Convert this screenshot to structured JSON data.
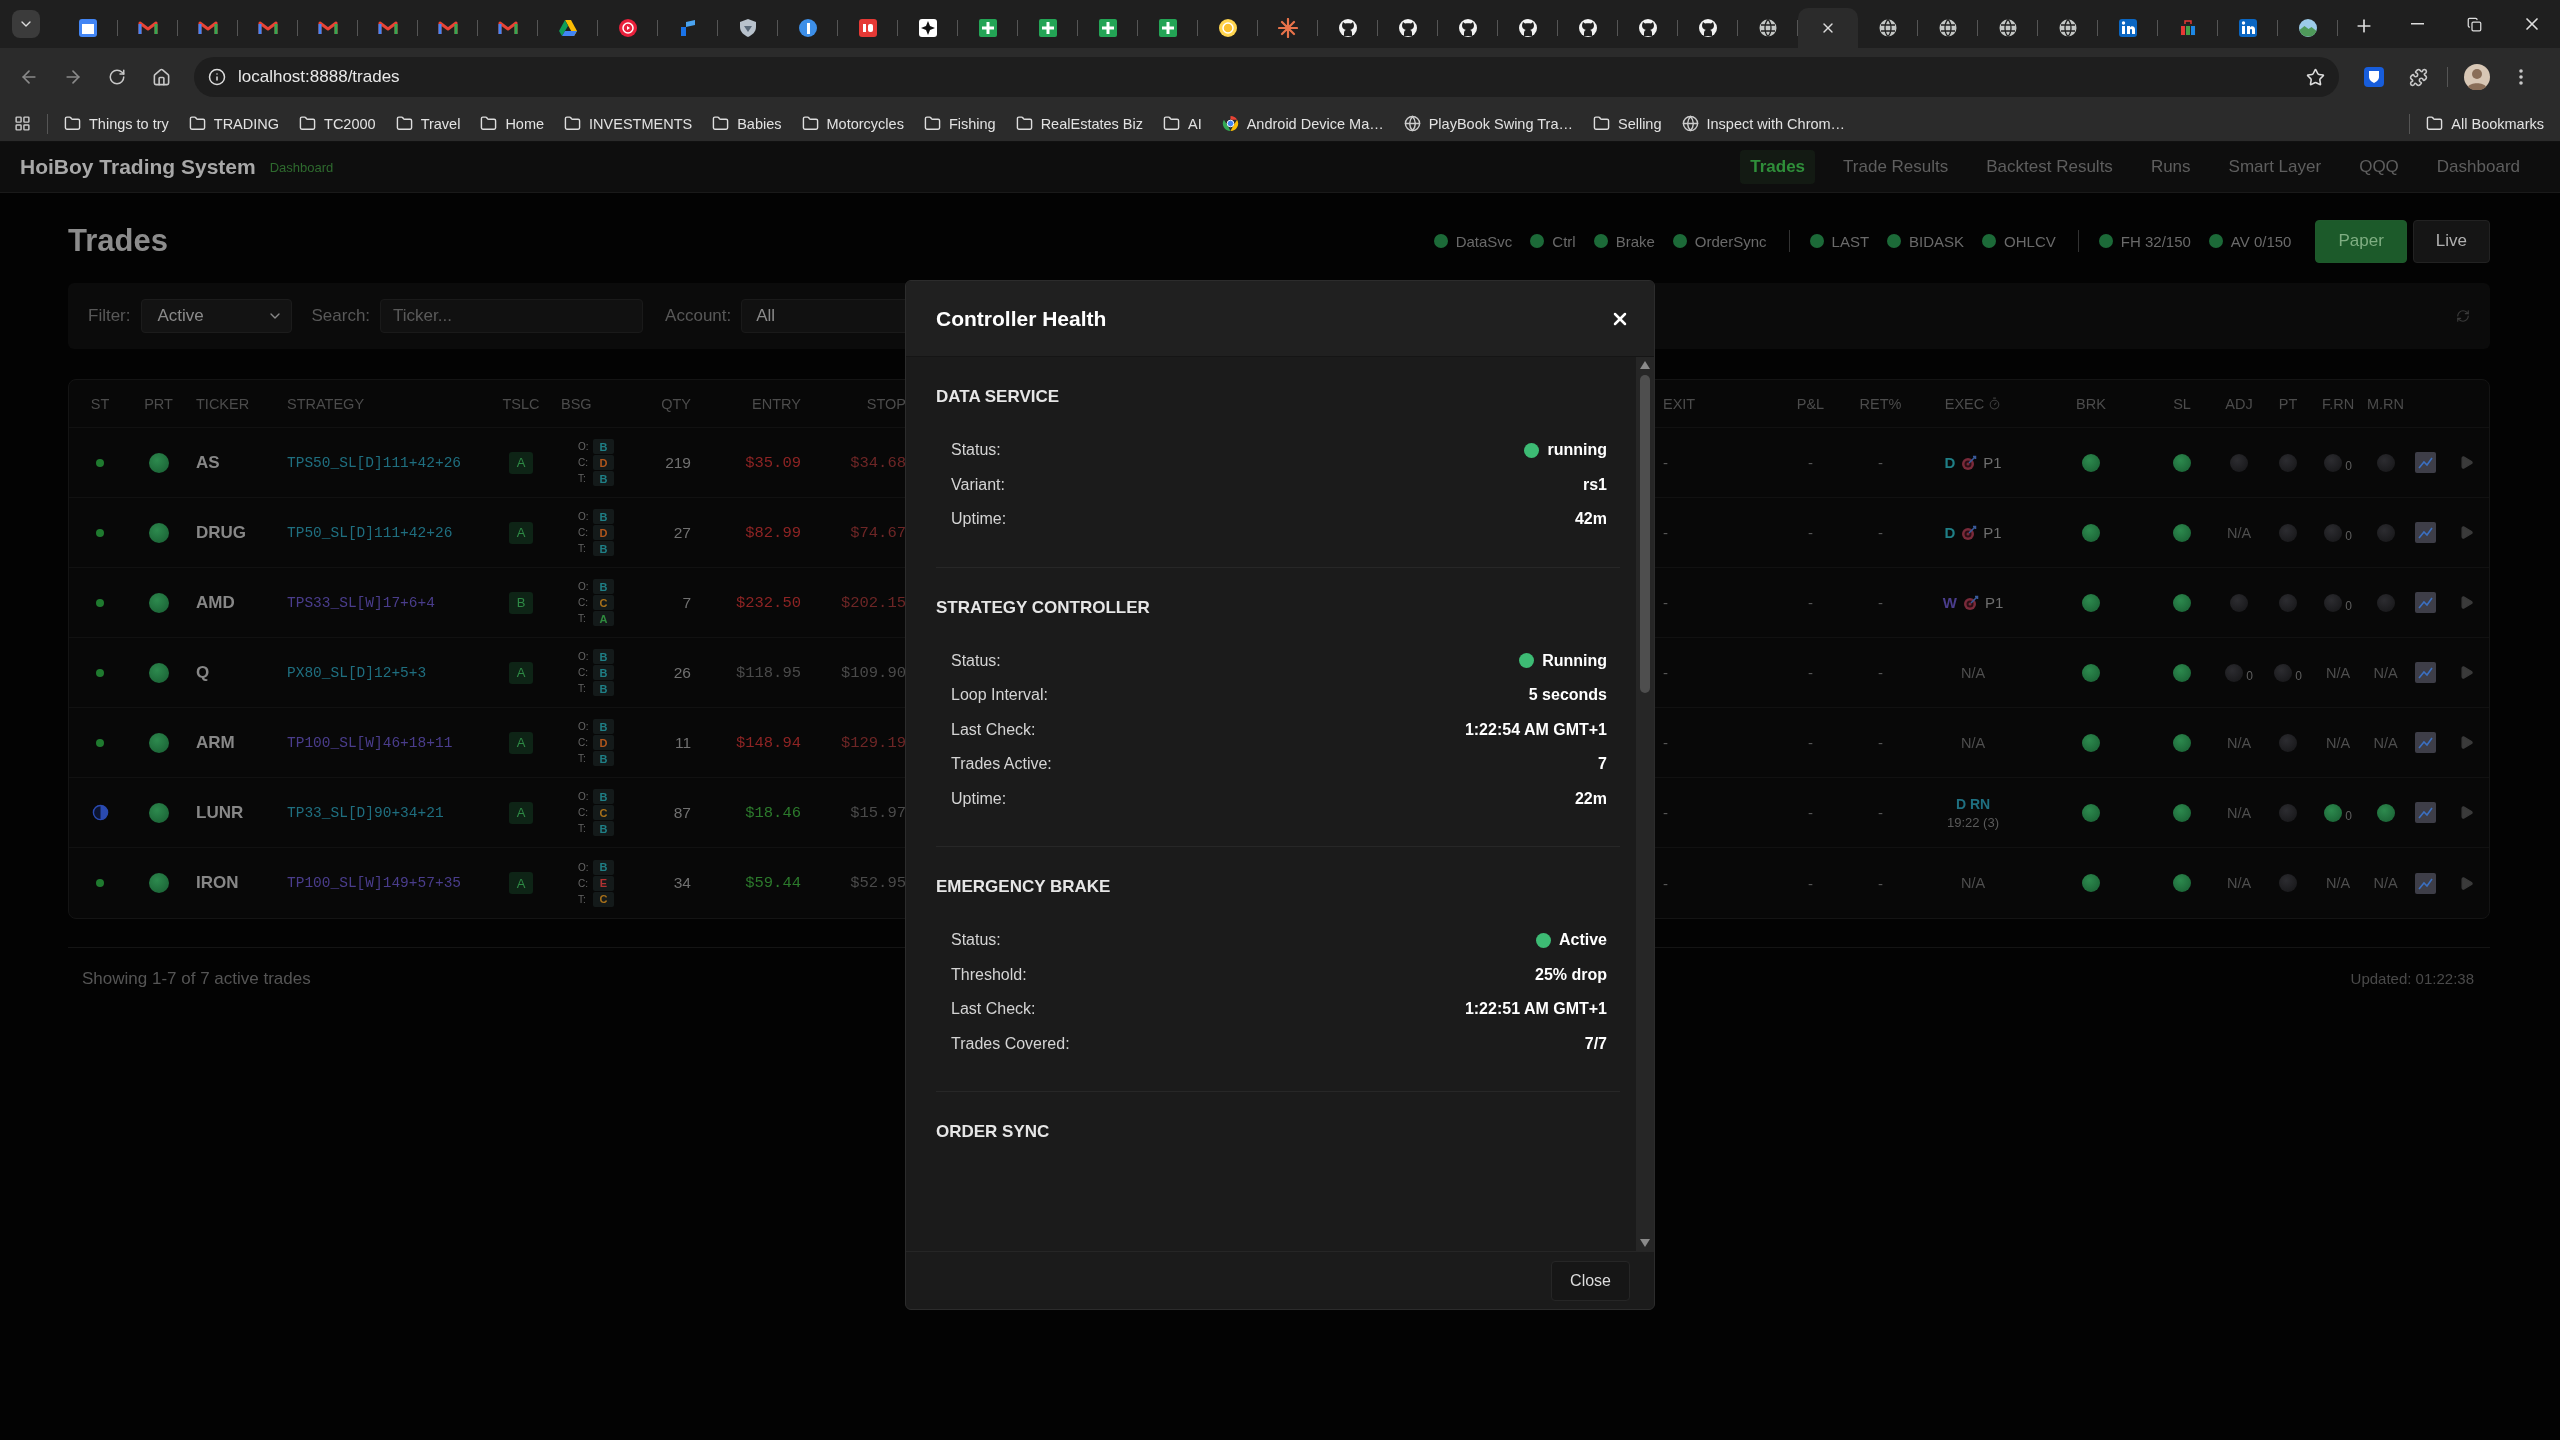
{
  "browser": {
    "tabs": [
      {
        "kind": "calendar",
        "selected": false
      },
      {
        "kind": "mail",
        "selected": false
      },
      {
        "kind": "mail",
        "selected": false
      },
      {
        "kind": "mail",
        "selected": false
      },
      {
        "kind": "mail",
        "selected": false
      },
      {
        "kind": "mail",
        "selected": false
      },
      {
        "kind": "mail",
        "selected": false
      },
      {
        "kind": "mail",
        "selected": false
      },
      {
        "kind": "drive",
        "selected": false
      },
      {
        "kind": "play",
        "selected": false
      },
      {
        "kind": "bars",
        "selected": false
      },
      {
        "kind": "shield",
        "selected": false
      },
      {
        "kind": "circle",
        "selected": false
      },
      {
        "kind": "tile",
        "selected": false
      },
      {
        "kind": "spark",
        "selected": false
      },
      {
        "kind": "sheet",
        "selected": false
      },
      {
        "kind": "sheet",
        "selected": false
      },
      {
        "kind": "sheet",
        "selected": false
      },
      {
        "kind": "sheet",
        "selected": false
      },
      {
        "kind": "bulb",
        "selected": false
      },
      {
        "kind": "burst",
        "selected": false
      },
      {
        "kind": "cat",
        "selected": false
      },
      {
        "kind": "cat",
        "selected": false
      },
      {
        "kind": "cat",
        "selected": false
      },
      {
        "kind": "cat",
        "selected": false
      },
      {
        "kind": "cat",
        "selected": false
      },
      {
        "kind": "cat",
        "selected": false
      },
      {
        "kind": "cat",
        "selected": false
      },
      {
        "kind": "globe",
        "selected": false
      },
      {
        "kind": "blank",
        "selected": true
      },
      {
        "kind": "globe",
        "selected": false
      },
      {
        "kind": "globe",
        "selected": false
      },
      {
        "kind": "globe",
        "selected": false
      },
      {
        "kind": "globe",
        "selected": false
      },
      {
        "kind": "profile",
        "selected": false
      },
      {
        "kind": "bag",
        "selected": false
      },
      {
        "kind": "profile",
        "selected": false
      },
      {
        "kind": "photo",
        "selected": false
      }
    ],
    "address": "localhost:8888/trades",
    "bookmarks": [
      {
        "label": "Things to try",
        "kind": "folder"
      },
      {
        "label": "TRADING",
        "kind": "folder"
      },
      {
        "label": "TC2000",
        "kind": "folder"
      },
      {
        "label": "Travel",
        "kind": "folder"
      },
      {
        "label": "Home",
        "kind": "folder"
      },
      {
        "label": "INVESTMENTS",
        "kind": "folder"
      },
      {
        "label": "Babies",
        "kind": "folder"
      },
      {
        "label": "Motorcycles",
        "kind": "folder"
      },
      {
        "label": "Fishing",
        "kind": "folder"
      },
      {
        "label": "RealEstates Biz",
        "kind": "folder"
      },
      {
        "label": "AI",
        "kind": "folder"
      },
      {
        "label": "Android Device Ma…",
        "kind": "ring"
      },
      {
        "label": "PlayBook Swing Tra…",
        "kind": "globe"
      },
      {
        "label": "Selling",
        "kind": "folder"
      },
      {
        "label": "Inspect with Chrom…",
        "kind": "globe"
      }
    ],
    "all_bookmarks": "All Bookmarks"
  },
  "app": {
    "brand": "HoiBoy Trading System",
    "brand_tag": "Dashboard",
    "nav": [
      {
        "label": "Trades",
        "selected": true
      },
      {
        "label": "Trade Results",
        "selected": false
      },
      {
        "label": "Backtest Results",
        "selected": false
      },
      {
        "label": "Runs",
        "selected": false
      },
      {
        "label": "Smart Layer",
        "selected": false
      },
      {
        "label": "QQQ",
        "selected": false
      },
      {
        "label": "Dashboard",
        "selected": false
      }
    ]
  },
  "page": {
    "title": "Trades",
    "status_groups": [
      {
        "items": [
          {
            "label": "DataSvc",
            "on": true
          },
          {
            "label": "Ctrl",
            "on": true
          },
          {
            "label": "Brake",
            "on": true
          },
          {
            "label": "OrderSync",
            "on": true
          }
        ]
      },
      {
        "items": [
          {
            "label": "LAST",
            "on": true
          },
          {
            "label": "BIDASK",
            "on": true
          },
          {
            "label": "OHLCV",
            "on": true
          }
        ]
      },
      {
        "items": [
          {
            "label": "FH 32/150",
            "on": true
          },
          {
            "label": "AV 0/150",
            "on": true
          }
        ]
      }
    ],
    "modes": [
      {
        "label": "Paper",
        "selected": true
      },
      {
        "label": "Live",
        "selected": false
      }
    ]
  },
  "filters": {
    "filter": {
      "label": "Filter:",
      "value": "Active"
    },
    "search": {
      "label": "Search:",
      "placeholder": "Ticker..."
    },
    "account": {
      "label": "Account:",
      "value": "All"
    }
  },
  "table": {
    "columns": [
      {
        "label": "ST"
      },
      {
        "label": "PRT"
      },
      {
        "label": "TICKER"
      },
      {
        "label": "STRATEGY"
      },
      {
        "label": "TSLC"
      },
      {
        "label": "BSG"
      },
      {
        "label": "QTY"
      },
      {
        "label": "ENTRY"
      },
      {
        "label": "STOP"
      },
      {
        "label": "EXIT"
      },
      {
        "label": "P&L"
      },
      {
        "label": "RET%"
      },
      {
        "label": "EXEC",
        "timer": true
      },
      {
        "label": "BRK"
      },
      {
        "label": "SL"
      },
      {
        "label": "ADJ"
      },
      {
        "label": "PT"
      },
      {
        "label": "F.RN"
      },
      {
        "label": "M.RN"
      }
    ],
    "rows": [
      {
        "st": {
          "kind": "dot"
        },
        "prt": {
          "on": true
        },
        "ticker": "AS",
        "strategy": {
          "text": "TPS50_SL[D]111+42+26",
          "color": "#1f6f80"
        },
        "tslc": "A",
        "bsg": [
          {
            "label": "O:",
            "grade": "B",
            "color": "#1f7f86"
          },
          {
            "label": "C:",
            "grade": "D",
            "color": "#b0561c"
          },
          {
            "label": "T:",
            "grade": "B",
            "color": "#1f7f86"
          }
        ],
        "qty": "219",
        "entry": {
          "text": "$35.09",
          "color": "#8e2424"
        },
        "stop": {
          "text": "$34.68",
          "color": "#6e2626"
        },
        "exit": "-",
        "pnl": "-",
        "ret": "-",
        "exec": {
          "kind": "signal",
          "timeframe": "D",
          "color": "#1f7f86",
          "priority": "P1"
        },
        "brk": {
          "on": true
        },
        "sl": {
          "on": true
        },
        "adj": {
          "kind": "dot",
          "on": false
        },
        "pt": {
          "kind": "dot",
          "on": false
        },
        "frn": {
          "kind": "dot",
          "on": false,
          "count": "0"
        },
        "mrn": {
          "kind": "dot",
          "on": false
        }
      },
      {
        "st": {
          "kind": "dot"
        },
        "prt": {
          "on": true
        },
        "ticker": "DRUG",
        "strategy": {
          "text": "TP50_SL[D]111+42+26",
          "color": "#1f6f80"
        },
        "tslc": "A",
        "bsg": [
          {
            "label": "O:",
            "grade": "B",
            "color": "#1f7f86"
          },
          {
            "label": "C:",
            "grade": "D",
            "color": "#b0561c"
          },
          {
            "label": "T:",
            "grade": "B",
            "color": "#1f7f86"
          }
        ],
        "qty": "27",
        "entry": {
          "text": "$82.99",
          "color": "#8e2424"
        },
        "stop": {
          "text": "$74.67",
          "color": "#6e2626"
        },
        "exit": "-",
        "pnl": "-",
        "ret": "-",
        "exec": {
          "kind": "signal",
          "timeframe": "D",
          "color": "#1f7f86",
          "priority": "P1"
        },
        "brk": {
          "on": true
        },
        "sl": {
          "on": true
        },
        "adj": {
          "kind": "na",
          "text": "N/A"
        },
        "pt": {
          "kind": "dot",
          "on": false
        },
        "frn": {
          "kind": "dot",
          "on": false,
          "count": "0"
        },
        "mrn": {
          "kind": "dot",
          "on": false
        }
      },
      {
        "st": {
          "kind": "dot"
        },
        "prt": {
          "on": true
        },
        "ticker": "AMD",
        "strategy": {
          "text": "TPS33_SL[W]17+6+4",
          "color": "#4a3d8c"
        },
        "tslc": "B",
        "bsg": [
          {
            "label": "O:",
            "grade": "B",
            "color": "#1f7f86"
          },
          {
            "label": "C:",
            "grade": "C",
            "color": "#a8701a"
          },
          {
            "label": "T:",
            "grade": "A",
            "color": "#2f8a3e"
          }
        ],
        "qty": "7",
        "entry": {
          "text": "$232.50",
          "color": "#8e2424"
        },
        "stop": {
          "text": "$202.15",
          "color": "#6e2626"
        },
        "exit": "-",
        "pnl": "-",
        "ret": "-",
        "exec": {
          "kind": "signal",
          "timeframe": "W",
          "color": "#4a3d8c",
          "priority": "P1"
        },
        "brk": {
          "on": true
        },
        "sl": {
          "on": true
        },
        "adj": {
          "kind": "dot",
          "on": false
        },
        "pt": {
          "kind": "dot",
          "on": false
        },
        "frn": {
          "kind": "dot",
          "on": false,
          "count": "0"
        },
        "mrn": {
          "kind": "dot",
          "on": false
        }
      },
      {
        "st": {
          "kind": "dot"
        },
        "prt": {
          "on": true
        },
        "ticker": "Q",
        "strategy": {
          "text": "PX80_SL[D]12+5+3",
          "color": "#1f6f80"
        },
        "tslc": "A",
        "bsg": [
          {
            "label": "O:",
            "grade": "B",
            "color": "#1f7f86"
          },
          {
            "label": "C:",
            "grade": "B",
            "color": "#1f7f86"
          },
          {
            "label": "T:",
            "grade": "B",
            "color": "#1f7f86"
          }
        ],
        "qty": "26",
        "entry": {
          "text": "$118.95",
          "color": "#4a4a4a"
        },
        "stop": {
          "text": "$109.90",
          "color": "#4a4a4a"
        },
        "exit": "-",
        "pnl": "-",
        "ret": "-",
        "exec": {
          "kind": "na",
          "text": "N/A"
        },
        "brk": {
          "on": true
        },
        "sl": {
          "on": true
        },
        "adj": {
          "kind": "dot",
          "on": false,
          "count": "0"
        },
        "pt": {
          "kind": "dot",
          "on": false,
          "count": "0"
        },
        "frn": {
          "kind": "na",
          "text": "N/A"
        },
        "mrn": {
          "kind": "na",
          "text": "N/A"
        }
      },
      {
        "st": {
          "kind": "dot"
        },
        "prt": {
          "on": true
        },
        "ticker": "ARM",
        "strategy": {
          "text": "TP100_SL[W]46+18+11",
          "color": "#4a3d8c"
        },
        "tslc": "A",
        "bsg": [
          {
            "label": "O:",
            "grade": "B",
            "color": "#1f7f86"
          },
          {
            "label": "C:",
            "grade": "D",
            "color": "#b0561c"
          },
          {
            "label": "T:",
            "grade": "B",
            "color": "#1f7f86"
          }
        ],
        "qty": "11",
        "entry": {
          "text": "$148.94",
          "color": "#8e2424"
        },
        "stop": {
          "text": "$129.19",
          "color": "#6e2626"
        },
        "exit": "-",
        "pnl": "-",
        "ret": "-",
        "exec": {
          "kind": "na",
          "text": "N/A"
        },
        "brk": {
          "on": true
        },
        "sl": {
          "on": true
        },
        "adj": {
          "kind": "na",
          "text": "N/A"
        },
        "pt": {
          "kind": "dot",
          "on": false
        },
        "frn": {
          "kind": "na",
          "text": "N/A"
        },
        "mrn": {
          "kind": "na",
          "text": "N/A"
        }
      },
      {
        "st": {
          "kind": "half"
        },
        "prt": {
          "on": true
        },
        "ticker": "LUNR",
        "strategy": {
          "text": "TP33_SL[D]90+34+21",
          "color": "#1f6f80"
        },
        "tslc": "A",
        "bsg": [
          {
            "label": "O:",
            "grade": "B",
            "color": "#1f7f86"
          },
          {
            "label": "C:",
            "grade": "C",
            "color": "#a8701a"
          },
          {
            "label": "T:",
            "grade": "B",
            "color": "#1f7f86"
          }
        ],
        "qty": "87",
        "entry": {
          "text": "$18.46",
          "color": "#2c7a2c"
        },
        "stop": {
          "text": "$15.97",
          "color": "#4a4a4a"
        },
        "exit": "-",
        "pnl": "-",
        "ret": "-",
        "exec": {
          "kind": "rerun",
          "label": "D RN",
          "time": "19:22 (3)"
        },
        "brk": {
          "on": true
        },
        "sl": {
          "on": true
        },
        "adj": {
          "kind": "na",
          "text": "N/A"
        },
        "pt": {
          "kind": "dot",
          "on": false
        },
        "frn": {
          "kind": "dot",
          "on": true,
          "count": "0"
        },
        "mrn": {
          "kind": "dot",
          "on": true
        }
      },
      {
        "st": {
          "kind": "dot"
        },
        "prt": {
          "on": true
        },
        "ticker": "IRON",
        "strategy": {
          "text": "TP100_SL[W]149+57+35",
          "color": "#4a3d8c"
        },
        "tslc": "A",
        "bsg": [
          {
            "label": "O:",
            "grade": "B",
            "color": "#1f7f86"
          },
          {
            "label": "C:",
            "grade": "E",
            "color": "#b03232"
          },
          {
            "label": "T:",
            "grade": "C",
            "color": "#a8701a"
          }
        ],
        "qty": "34",
        "entry": {
          "text": "$59.44",
          "color": "#2c7a2c"
        },
        "stop": {
          "text": "$52.95",
          "color": "#4a4a4a"
        },
        "exit": "-",
        "pnl": "-",
        "ret": "-",
        "exec": {
          "kind": "na",
          "text": "N/A"
        },
        "brk": {
          "on": true
        },
        "sl": {
          "on": true
        },
        "adj": {
          "kind": "na",
          "text": "N/A"
        },
        "pt": {
          "kind": "dot",
          "on": false
        },
        "frn": {
          "kind": "na",
          "text": "N/A"
        },
        "mrn": {
          "kind": "na",
          "text": "N/A"
        }
      }
    ]
  },
  "footer": {
    "summary": "Showing 1-7 of 7 active trades",
    "updated": "Updated: 01:22:38"
  },
  "dialog": {
    "title": "Controller Health",
    "close_label": "Close",
    "sections": [
      {
        "title": "DATA SERVICE",
        "rows": [
          {
            "label": "Status:",
            "value": "running",
            "healthy": true
          },
          {
            "label": "Variant:",
            "value": "rs1"
          },
          {
            "label": "Uptime:",
            "value": "42m"
          }
        ]
      },
      {
        "title": "STRATEGY CONTROLLER",
        "rows": [
          {
            "label": "Status:",
            "value": "Running",
            "healthy": true
          },
          {
            "label": "Loop Interval:",
            "value": "5 seconds"
          },
          {
            "label": "Last Check:",
            "value": "1:22:54 AM GMT+1"
          },
          {
            "label": "Trades Active:",
            "value": "7"
          },
          {
            "label": "Uptime:",
            "value": "22m"
          }
        ]
      },
      {
        "title": "EMERGENCY BRAKE",
        "rows": [
          {
            "label": "Status:",
            "value": "Active",
            "healthy": true
          },
          {
            "label": "Threshold:",
            "value": "25% drop"
          },
          {
            "label": "Last Check:",
            "value": "1:22:51 AM GMT+1"
          },
          {
            "label": "Trades Covered:",
            "value": "7/7"
          }
        ]
      },
      {
        "title": "ORDER SYNC"
      }
    ]
  }
}
